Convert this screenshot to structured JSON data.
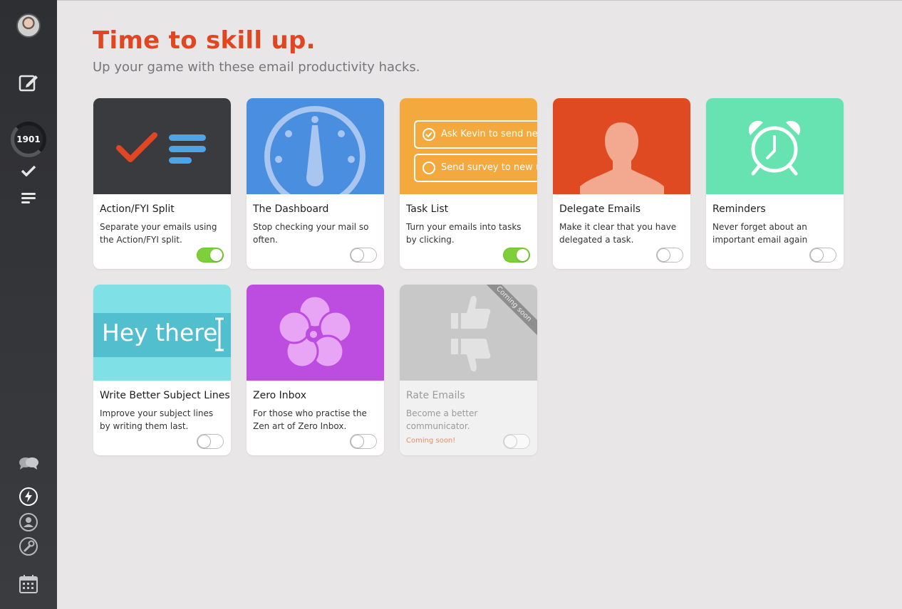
{
  "header": {
    "title": "Time to skill up.",
    "subtitle": "Up your game with these email productivity hacks."
  },
  "sidebar": {
    "counter": "1901",
    "icons": [
      "avatar",
      "compose-icon",
      "check-icon",
      "fyi-lines-icon",
      "chat-icon",
      "lightning-icon",
      "contact-icon",
      "wrench-icon",
      "calendar-icon"
    ]
  },
  "cards": [
    {
      "title": "Action/FYI Split",
      "desc": "Separate your emails using the Action/FYI split.",
      "enabled": true,
      "thumb_color": "#3a3b3f"
    },
    {
      "title": "The Dashboard",
      "desc": "Stop checking your mail so often.",
      "enabled": false,
      "thumb_color": "#4a8ee0"
    },
    {
      "title": "Task List",
      "desc": "Turn your emails into tasks by clicking.",
      "enabled": true,
      "thumb_color": "#f3a93d",
      "tasks": [
        "Ask Kevin to send new",
        "Send survey to new u"
      ]
    },
    {
      "title": "Delegate Emails",
      "desc": "Make it clear that you have delegated a task.",
      "enabled": false,
      "thumb_color": "#e04a23"
    },
    {
      "title": "Reminders",
      "desc": "Never forget about an important email again",
      "enabled": false,
      "thumb_color": "#66e3b0"
    },
    {
      "title": "Write Better Subject Lines",
      "desc": "Improve your subject lines by writing them last.",
      "enabled": false,
      "thumb_color": "#7fe0e5",
      "sample": "Hey there"
    },
    {
      "title": "Zero Inbox",
      "desc": "For those who practise the Zen art of Zero Inbox.",
      "enabled": false,
      "thumb_color": "#bd4de0"
    },
    {
      "title": "Rate Emails",
      "desc": "Become a better communicator.",
      "enabled": false,
      "thumb_color": "#c8c8c8",
      "ribbon": "Coming soon",
      "note": "Coming soon!"
    }
  ]
}
